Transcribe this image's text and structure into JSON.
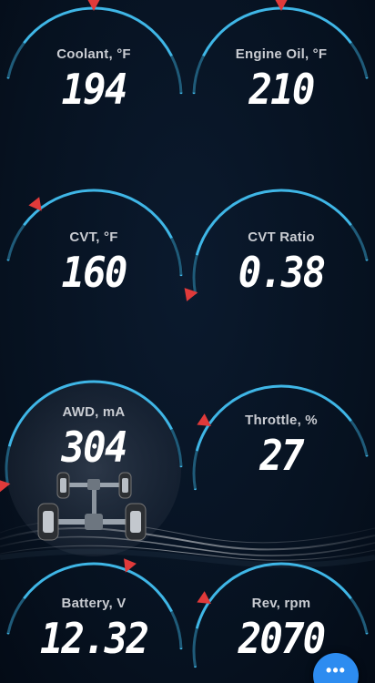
{
  "gauges": [
    {
      "id": "coolant",
      "label": "Coolant, °F",
      "value": "194",
      "needle_color": "#e03a3a"
    },
    {
      "id": "engine-oil",
      "label": "Engine Oil, °F",
      "value": "210",
      "needle_color": "#e03a3a"
    },
    {
      "id": "cvt",
      "label": "CVT, °F",
      "value": "160",
      "needle_color": "#e03a3a"
    },
    {
      "id": "cvt-ratio",
      "label": "CVT Ratio",
      "value": "0.38",
      "needle_color": "#e03a3a"
    },
    {
      "id": "awd",
      "label": "AWD, mA",
      "value": "304",
      "needle_color": "#e03a3a"
    },
    {
      "id": "throttle",
      "label": "Throttle, %",
      "value": "27",
      "needle_color": "#e03a3a"
    },
    {
      "id": "battery",
      "label": "Battery, V",
      "value": "12.32",
      "needle_color": "#e03a3a"
    },
    {
      "id": "rev",
      "label": "Rev, rpm",
      "value": "2070",
      "needle_color": "#e03a3a"
    }
  ],
  "colors": {
    "arc_blue": "#3fb6e6",
    "background": "#06111f",
    "accent_button": "#2d8cf0"
  },
  "menu": {
    "icon": "more-dots-icon",
    "label": "•••"
  }
}
